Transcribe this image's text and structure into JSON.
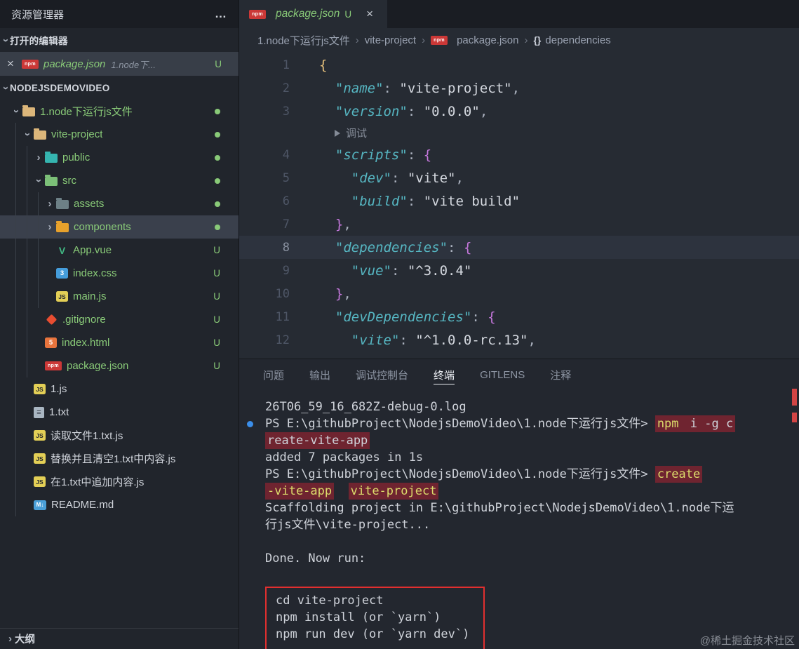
{
  "colors": {
    "bg_editor": "#262b33",
    "bg_sidebar": "#21252c",
    "bg_titlebar": "#1a1d23",
    "bg_panel": "#23272f",
    "green": "#89ca78",
    "fg": "#d7dae0",
    "fg_dim": "#9aa2b1",
    "key_cyan": "#56b6c2",
    "brace_gold": "#e5c07b",
    "brace_pink": "#c678dd",
    "punct": "#abb2bf",
    "line_number": "#4e5666",
    "hl_line": "#2d333e",
    "selected_row": "#3a404c",
    "terminal_fg": "#cfd3da",
    "terminal_yellow": "#dcdc6b",
    "red_highlight_bg": "#6f2430",
    "annotation_red": "#e12f2f",
    "blue_dot": "#3b8eea",
    "npm_red": "#cb3837"
  },
  "sidebar": {
    "title": "资源管理器",
    "open_editors_label": "打开的编辑器",
    "open_editor": {
      "iconText": "npm",
      "name": "package.json",
      "detail": "1.node下...",
      "badge": "U"
    },
    "workspace_label": "NODEJSDEMOVIDEO",
    "outline_label": "大纲",
    "tree": [
      {
        "label": "1.node下运行js文件",
        "icon": "folder",
        "iconColor": "#dcb67a",
        "indent": 0,
        "chevron": "down",
        "dot": true,
        "green": true
      },
      {
        "label": "vite-project",
        "icon": "folder",
        "iconColor": "#dcb67a",
        "indent": 1,
        "chevron": "down",
        "dot": true,
        "green": true
      },
      {
        "label": "public",
        "icon": "folder",
        "iconColor": "#35b5b0",
        "indent": 2,
        "chevron": "right",
        "dot": true,
        "green": true
      },
      {
        "label": "src",
        "icon": "folder",
        "iconColor": "#7cc078",
        "indent": 2,
        "chevron": "down",
        "dot": true,
        "green": true
      },
      {
        "label": "assets",
        "icon": "folder",
        "iconColor": "#6d8086",
        "indent": 3,
        "chevron": "right",
        "dot": true,
        "green": true
      },
      {
        "label": "components",
        "icon": "folder",
        "iconColor": "#e7a12c",
        "indent": 3,
        "chevron": "right",
        "dot": true,
        "green": true,
        "selected": true
      },
      {
        "label": "App.vue",
        "icon": "vue",
        "iconText": "V",
        "indent": 3,
        "badge": "U",
        "green": true
      },
      {
        "label": "index.css",
        "icon": "css",
        "iconText": "3",
        "indent": 3,
        "badge": "U",
        "green": true
      },
      {
        "label": "main.js",
        "icon": "js",
        "iconText": "JS",
        "indent": 3,
        "badge": "U",
        "green": true
      },
      {
        "label": ".gitignore",
        "icon": "git",
        "indent": 2,
        "badge": "U",
        "green": true
      },
      {
        "label": "index.html",
        "icon": "html",
        "iconText": "5",
        "indent": 2,
        "badge": "U",
        "green": true
      },
      {
        "label": "package.json",
        "icon": "npm",
        "iconText": "npm",
        "indent": 2,
        "badge": "U",
        "green": true
      },
      {
        "label": "1.js",
        "icon": "js",
        "iconText": "JS",
        "indent": 1
      },
      {
        "label": "1.txt",
        "icon": "txt",
        "iconText": "≡",
        "indent": 1
      },
      {
        "label": "读取文件1.txt.js",
        "icon": "js",
        "iconText": "JS",
        "indent": 1
      },
      {
        "label": "替换并且清空1.txt中内容.js",
        "icon": "js",
        "iconText": "JS",
        "indent": 1
      },
      {
        "label": "在1.txt中追加内容.js",
        "icon": "js",
        "iconText": "JS",
        "indent": 1
      },
      {
        "label": "README.md",
        "icon": "md",
        "iconText": "M↓",
        "indent": 1
      }
    ]
  },
  "editor": {
    "tab": {
      "iconText": "npm",
      "name": "package.json",
      "badge": "U"
    },
    "breadcrumb": [
      {
        "label": "1.node下运行js文件"
      },
      {
        "label": "vite-project"
      },
      {
        "label": "package.json",
        "icon": "npm",
        "iconText": "npm"
      },
      {
        "label": "dependencies",
        "icon": "braces",
        "iconText": "{}"
      }
    ],
    "lines": [
      {
        "num": 1,
        "tokens": [
          {
            "t": "{",
            "c": "b1"
          }
        ]
      },
      {
        "num": 2,
        "tokens": [
          {
            "t": "  "
          },
          {
            "t": "\"name\"",
            "c": "key"
          },
          {
            "t": ": ",
            "c": "pun"
          },
          {
            "t": "\"vite-project\"",
            "c": "str"
          },
          {
            "t": ",",
            "c": "pun"
          }
        ]
      },
      {
        "num": 3,
        "tokens": [
          {
            "t": "  "
          },
          {
            "t": "\"version\"",
            "c": "key"
          },
          {
            "t": ": ",
            "c": "pun"
          },
          {
            "t": "\"0.0.0\"",
            "c": "str"
          },
          {
            "t": ",",
            "c": "pun"
          }
        ]
      },
      {
        "lens": true,
        "label": "调试"
      },
      {
        "num": 4,
        "tokens": [
          {
            "t": "  "
          },
          {
            "t": "\"scripts\"",
            "c": "key"
          },
          {
            "t": ": ",
            "c": "pun"
          },
          {
            "t": "{",
            "c": "b2"
          }
        ]
      },
      {
        "num": 5,
        "tokens": [
          {
            "t": "    "
          },
          {
            "t": "\"dev\"",
            "c": "key"
          },
          {
            "t": ": ",
            "c": "pun"
          },
          {
            "t": "\"vite\"",
            "c": "str"
          },
          {
            "t": ",",
            "c": "pun"
          }
        ]
      },
      {
        "num": 6,
        "tokens": [
          {
            "t": "    "
          },
          {
            "t": "\"build\"",
            "c": "key"
          },
          {
            "t": ": ",
            "c": "pun"
          },
          {
            "t": "\"vite build\"",
            "c": "str"
          }
        ]
      },
      {
        "num": 7,
        "tokens": [
          {
            "t": "  "
          },
          {
            "t": "}",
            "c": "b2"
          },
          {
            "t": ",",
            "c": "pun"
          }
        ]
      },
      {
        "num": 8,
        "highlight": true,
        "tokens": [
          {
            "t": "  "
          },
          {
            "t": "\"dependencies\"",
            "c": "key"
          },
          {
            "t": ": ",
            "c": "pun"
          },
          {
            "t": "{",
            "c": "b2"
          }
        ]
      },
      {
        "num": 9,
        "tokens": [
          {
            "t": "    "
          },
          {
            "t": "\"vue\"",
            "c": "key"
          },
          {
            "t": ": ",
            "c": "pun"
          },
          {
            "t": "\"^3.0.4\"",
            "c": "str"
          }
        ]
      },
      {
        "num": 10,
        "tokens": [
          {
            "t": "  "
          },
          {
            "t": "}",
            "c": "b2"
          },
          {
            "t": ",",
            "c": "pun"
          }
        ]
      },
      {
        "num": 11,
        "tokens": [
          {
            "t": "  "
          },
          {
            "t": "\"devDependencies\"",
            "c": "key"
          },
          {
            "t": ": ",
            "c": "pun"
          },
          {
            "t": "{",
            "c": "b2"
          }
        ]
      },
      {
        "num": 12,
        "tokens": [
          {
            "t": "    "
          },
          {
            "t": "\"vite\"",
            "c": "key"
          },
          {
            "t": ": ",
            "c": "pun"
          },
          {
            "t": "\"^1.0.0-rc.13\"",
            "c": "str"
          },
          {
            "t": ",",
            "c": "pun"
          }
        ]
      }
    ]
  },
  "panel": {
    "tabs": [
      {
        "label": "问题"
      },
      {
        "label": "输出"
      },
      {
        "label": "调试控制台"
      },
      {
        "label": "终端",
        "active": true
      },
      {
        "label": "GITLENS"
      },
      {
        "label": "注释"
      }
    ],
    "terminal_blocks": [
      {
        "type": "lines",
        "lines": [
          {
            "segs": [
              {
                "t": "26T06_59_16_682Z-debug-0.log"
              }
            ]
          },
          {
            "dot": true,
            "segs": [
              {
                "t": "PS E:\\githubProject\\NodejsDemoVideo\\1.node下运行js文件> "
              },
              {
                "t": "npm",
                "c": "yellow",
                "hl": true
              },
              {
                "t": " i -g c",
                "hl": true
              }
            ]
          },
          {
            "segs": [
              {
                "t": "reate-vite-app",
                "hl": true
              }
            ]
          },
          {
            "segs": [
              {
                "t": "added 7 packages in 1s"
              }
            ]
          },
          {
            "segs": [
              {
                "t": "PS E:\\githubProject\\NodejsDemoVideo\\1.node下运行js文件> "
              },
              {
                "t": "create",
                "c": "yellow",
                "hl": true
              }
            ]
          },
          {
            "segs": [
              {
                "t": "-vite-app",
                "c": "yellow",
                "hl": true
              },
              {
                "t": "  "
              },
              {
                "t": "vite-project",
                "c": "yellow",
                "hl": true
              }
            ]
          },
          {
            "segs": [
              {
                "t": "Scaffolding project in E:\\githubProject\\NodejsDemoVideo\\1.node下运"
              }
            ]
          },
          {
            "segs": [
              {
                "t": "行js文件\\vite-project..."
              }
            ]
          },
          {
            "segs": []
          },
          {
            "segs": [
              {
                "t": "Done. Now run:"
              }
            ]
          },
          {
            "segs": []
          }
        ]
      },
      {
        "type": "boxed",
        "lines": [
          {
            "segs": [
              {
                "t": "cd vite-project"
              }
            ]
          },
          {
            "segs": [
              {
                "t": "npm install (or `yarn`)"
              }
            ]
          },
          {
            "segs": [
              {
                "t": "npm run dev (or `yarn dev`)"
              }
            ]
          }
        ]
      }
    ]
  },
  "watermark": "@稀土掘金技术社区"
}
